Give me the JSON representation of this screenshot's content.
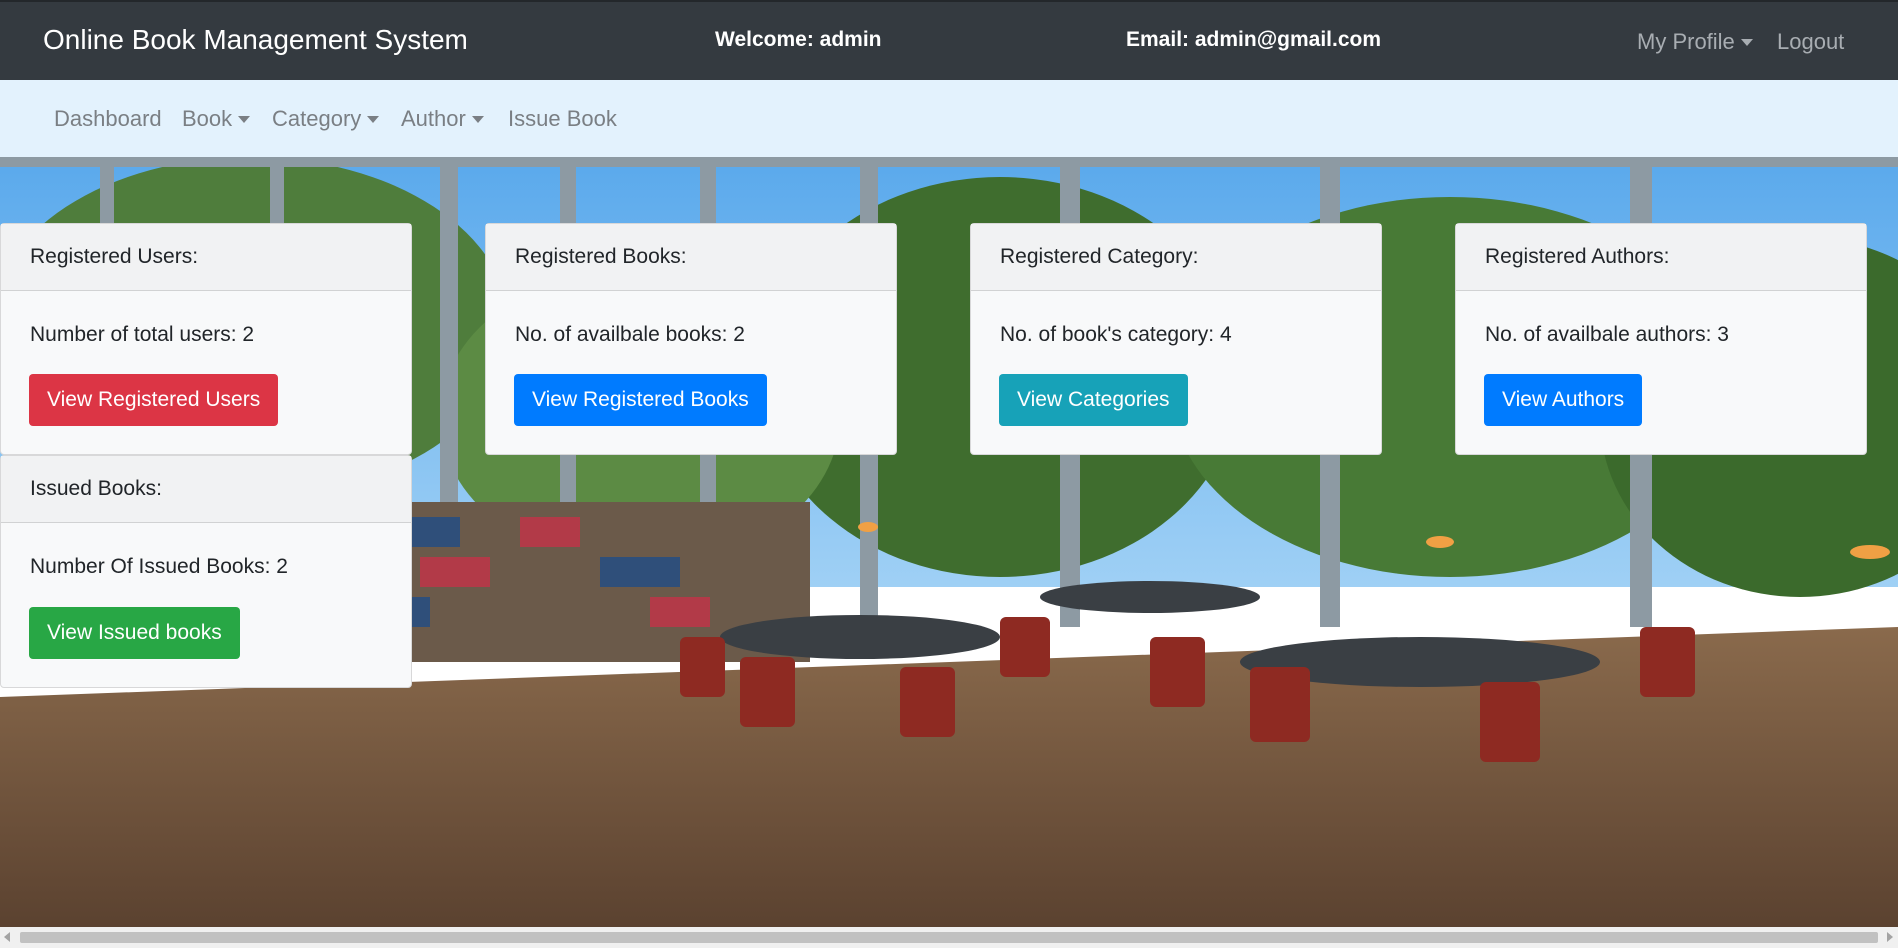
{
  "header": {
    "brand": "Online Book Management System",
    "welcome": "Welcome: admin",
    "email": "Email: admin@gmail.com",
    "profile_label": "My Profile",
    "logout_label": "Logout"
  },
  "subnav": {
    "items": [
      {
        "label": "Dashboard",
        "dropdown": false
      },
      {
        "label": "Book",
        "dropdown": true
      },
      {
        "label": "Category",
        "dropdown": true
      },
      {
        "label": "Author",
        "dropdown": true
      },
      {
        "label": "Issue Book",
        "dropdown": false
      }
    ]
  },
  "cards": {
    "users": {
      "header": "Registered Users:",
      "text": "Number of total users: 2",
      "button": "View Registered Users"
    },
    "books": {
      "header": "Registered Books:",
      "text": "No. of availbale books: 2",
      "button": "View Registered Books"
    },
    "category": {
      "header": "Registered Category:",
      "text": "No. of book's category: 4",
      "button": "View Categories"
    },
    "authors": {
      "header": "Registered Authors:",
      "text": "No. of availbale authors: 3",
      "button": "View Authors"
    },
    "issued": {
      "header": "Issued Books:",
      "text": "Number Of Issued Books: 2",
      "button": "View Issued books"
    }
  },
  "colors": {
    "navbar": "#343a40",
    "subnav": "#e3f2fd",
    "danger": "#dc3545",
    "primary": "#007bff",
    "info": "#17a2b8",
    "success": "#28a745"
  }
}
